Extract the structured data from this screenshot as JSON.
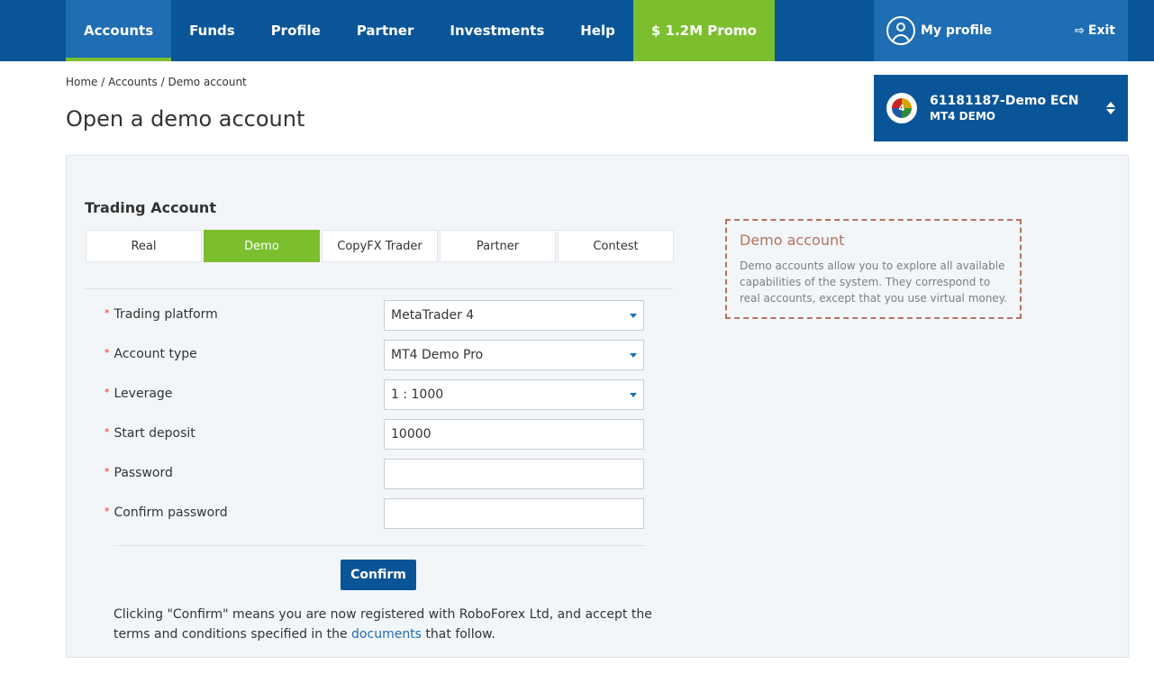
{
  "nav": {
    "items": [
      {
        "label": "Accounts",
        "active": true
      },
      {
        "label": "Funds"
      },
      {
        "label": "Profile"
      },
      {
        "label": "Partner"
      },
      {
        "label": "Investments"
      },
      {
        "label": "Help"
      },
      {
        "label": "$ 1.2M Promo",
        "promo": true
      }
    ],
    "profile_label": "My profile",
    "exit_label": "Exit"
  },
  "breadcrumb": "Home / Accounts / Demo account",
  "page_title": "Open a demo account",
  "account_switcher": {
    "account_id": "61181187-Demo ECN",
    "account_type": "MT4 DEMO",
    "logo_glyph": "4"
  },
  "trading_account": {
    "title": "Trading Account",
    "tabs": [
      "Real",
      "Demo",
      "CopyFX Trader",
      "Partner",
      "Contest"
    ],
    "active_tab": "Demo"
  },
  "form": {
    "required_mark": "*",
    "fields": [
      {
        "label": "Trading platform",
        "value": "MetaTrader 4",
        "type": "select"
      },
      {
        "label": "Account type",
        "value": "MT4 Demo Pro",
        "type": "select"
      },
      {
        "label": "Leverage",
        "value": "1 : 1000",
        "type": "select"
      },
      {
        "label": "Start deposit",
        "value": "10000",
        "type": "input"
      },
      {
        "label": "Password",
        "value": "",
        "type": "input"
      },
      {
        "label": "Confirm password",
        "value": "",
        "type": "input"
      }
    ],
    "confirm_label": "Confirm",
    "notice_prefix": "Clicking \"Confirm\" means you are now registered with RoboForex Ltd, and accept the terms and conditions specified in the ",
    "notice_link": "documents",
    "notice_suffix": " that follow."
  },
  "info_box": {
    "title": "Demo account",
    "text": "Demo accounts allow you to explore all available capabilities of the system. They correspond to real accounts, except that you use virtual money."
  },
  "colors": {
    "nav_bg": "#0a5598",
    "nav_active": "#1f6db3",
    "accent_green": "#7bbf2e",
    "info_border": "#b5735f"
  }
}
